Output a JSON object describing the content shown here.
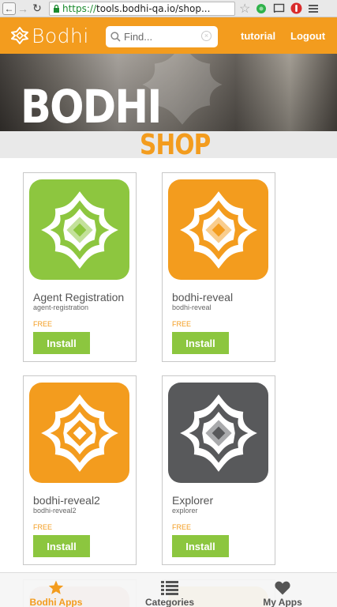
{
  "browser": {
    "url_scheme": "https://",
    "url_rest": "tools.bodhi-qa.io/shop..."
  },
  "header": {
    "logo_text": "Bodhi",
    "search_placeholder": "Find...",
    "tutorial_link": "tutorial",
    "logout_link": "Logout"
  },
  "banner": {
    "title": "BODHI",
    "subtitle": "SHOP"
  },
  "apps": [
    {
      "name": "Agent Registration",
      "id": "agent-registration",
      "price": "FREE",
      "install_label": "Install",
      "color": "#8dc63f"
    },
    {
      "name": "bodhi-reveal",
      "id": "bodhi-reveal",
      "price": "FREE",
      "install_label": "Install",
      "color": "#f39c1e"
    },
    {
      "name": "bodhi-reveal2",
      "id": "bodhi-reveal2",
      "price": "FREE",
      "install_label": "Install",
      "color": "#f39c1e"
    },
    {
      "name": "Explorer",
      "id": "explorer",
      "price": "FREE",
      "install_label": "Install",
      "color": "#58595b"
    }
  ],
  "bottom_nav": {
    "items": [
      {
        "label": "Bodhi Apps",
        "icon": "star-icon",
        "active": true
      },
      {
        "label": "Categories",
        "icon": "list-icon",
        "active": false
      },
      {
        "label": "My Apps",
        "icon": "heart-icon",
        "active": false
      }
    ]
  },
  "colors": {
    "brand_orange": "#f39c1e",
    "install_green": "#8cc63f",
    "active_nav": "#f39c1e",
    "inactive_nav": "#555555"
  }
}
